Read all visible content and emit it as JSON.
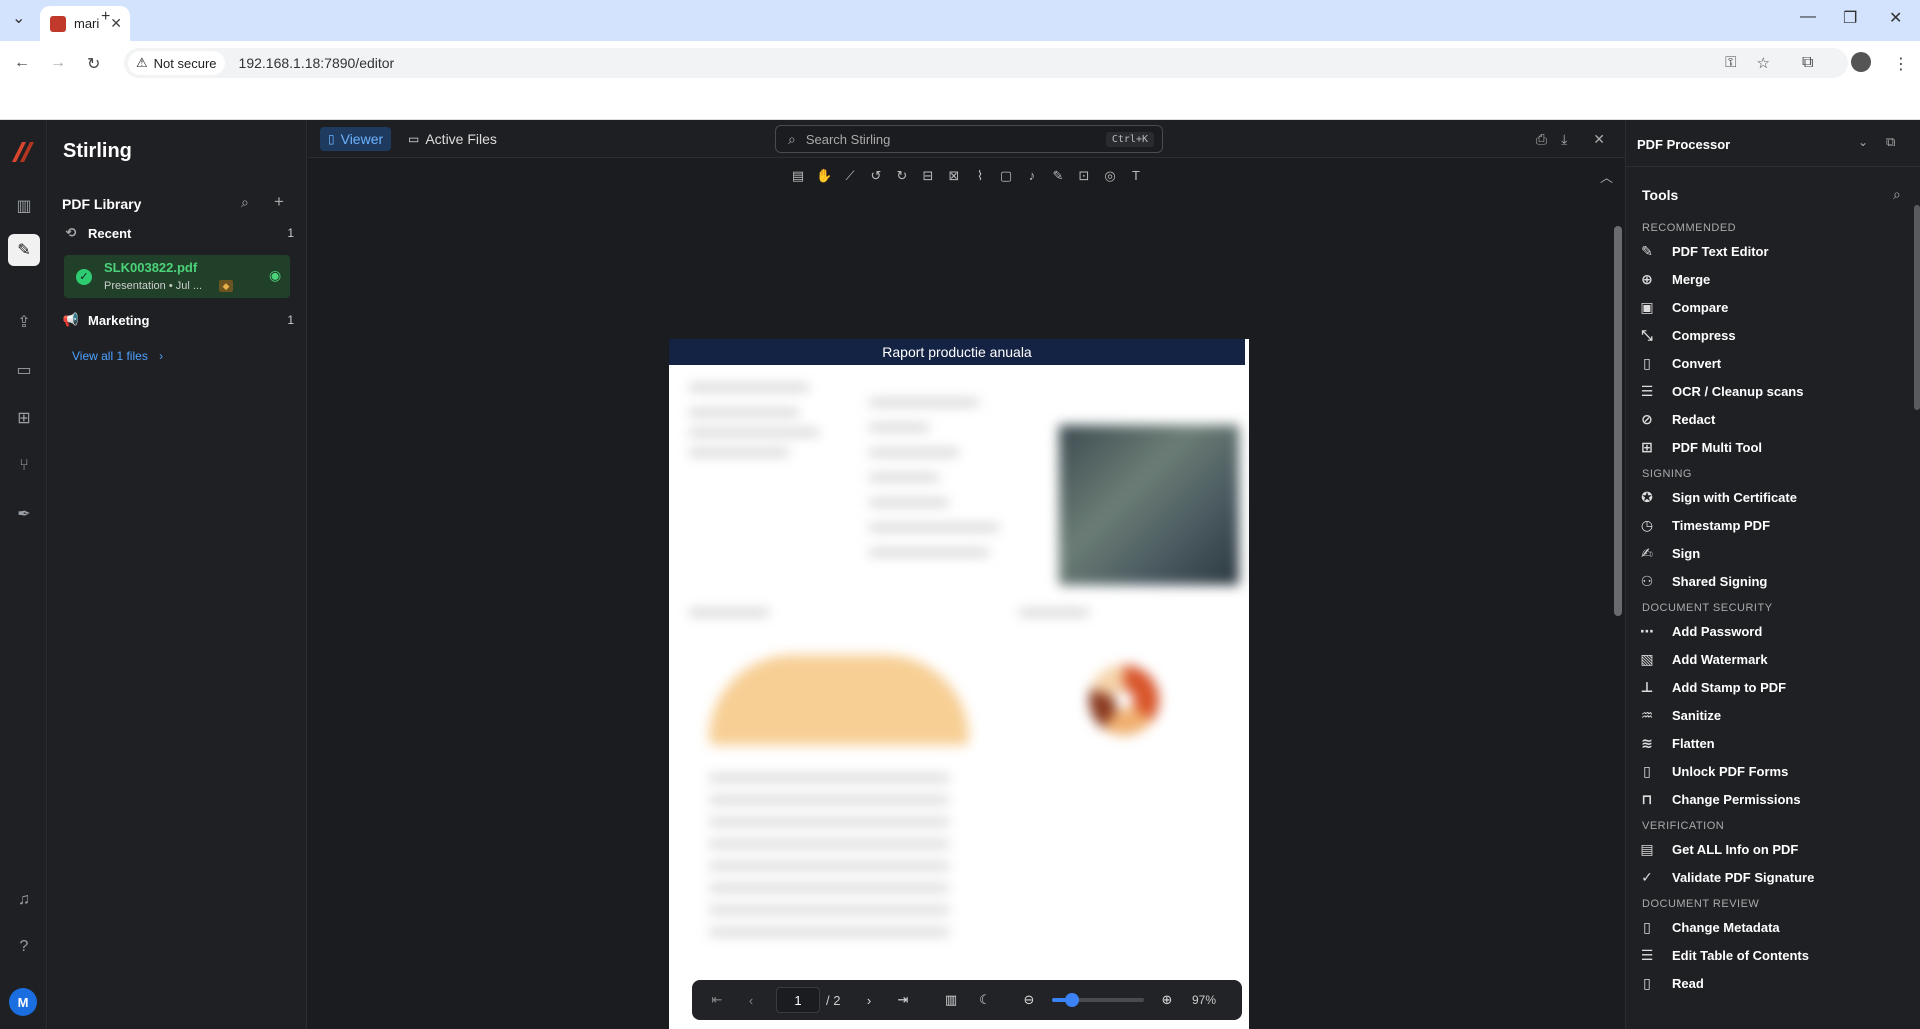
{
  "browser": {
    "tab_title": "mari",
    "security_label": "Not secure",
    "url": "192.168.1.18:7890/editor"
  },
  "app": {
    "brand": "Stirling",
    "library": {
      "title": "PDF Library",
      "recent_label": "Recent",
      "recent_count": "1",
      "file_name": "SLK003822.pdf",
      "file_meta": "Presentation • Jul ...",
      "marketing_label": "Marketing",
      "marketing_count": "1",
      "view_all": "View all 1 files"
    },
    "viewer": {
      "tab_viewer": "Viewer",
      "tab_active_files": "Active Files",
      "search_placeholder": "Search Stirling",
      "search_shortcut": "Ctrl+K",
      "page_header": "Raport productie anuala",
      "current_page": "1",
      "page_total": "/ 2",
      "zoom": "97%",
      "zoom_fraction": 0.22
    },
    "panel": {
      "title": "PDF Processor",
      "tools_label": "Tools",
      "sections": [
        {
          "label": "RECOMMENDED",
          "items": [
            "PDF Text Editor",
            "Merge",
            "Compare",
            "Compress",
            "Convert",
            "OCR / Cleanup scans",
            "Redact",
            "PDF Multi Tool"
          ]
        },
        {
          "label": "SIGNING",
          "items": [
            "Sign with Certificate",
            "Timestamp PDF",
            "Sign",
            "Shared Signing"
          ]
        },
        {
          "label": "DOCUMENT SECURITY",
          "items": [
            "Add Password",
            "Add Watermark",
            "Add Stamp to PDF",
            "Sanitize",
            "Flatten",
            "Unlock PDF Forms",
            "Change Permissions"
          ]
        },
        {
          "label": "VERIFICATION",
          "items": [
            "Get ALL Info on PDF",
            "Validate PDF Signature"
          ]
        },
        {
          "label": "DOCUMENT REVIEW",
          "items": [
            "Change Metadata",
            "Edit Table of Contents",
            "Read"
          ]
        }
      ]
    }
  }
}
